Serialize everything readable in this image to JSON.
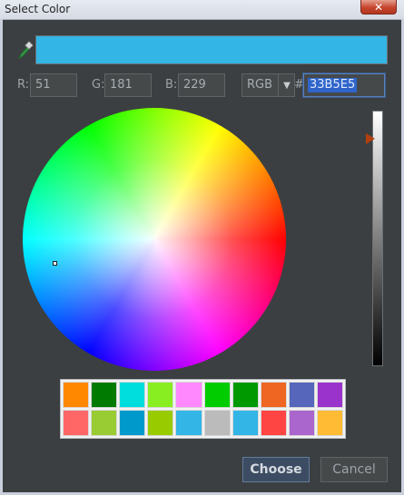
{
  "window": {
    "title": "Select Color",
    "close_glyph": "✕"
  },
  "selected_color": "#33B5E5",
  "rgb": {
    "r_label": "R:",
    "r_value": "51",
    "g_label": "G:",
    "g_value": "181",
    "b_label": "B:",
    "b_value": "229"
  },
  "mode": {
    "selected": "RGB",
    "arrow": "▼"
  },
  "hex": {
    "prefix": "#",
    "value": "33B5E5"
  },
  "icons": {
    "picker": "eyedropper-icon",
    "dropdown": "chevron-down-icon",
    "close": "close-icon"
  },
  "swatches": [
    "#FF8800",
    "#007A00",
    "#00DDDD",
    "#88EE22",
    "#FF88FF",
    "#00CC00",
    "#009900",
    "#EE6622",
    "#5566BB",
    "#9933CC",
    "#FF6666",
    "#99CC33",
    "#0099CC",
    "#99CC00",
    "#33B5E5",
    "#BBBBBB",
    "#33B5E5",
    "#FF4444",
    "#AA66CC",
    "#FFBB33"
  ],
  "buttons": {
    "choose": "Choose",
    "cancel": "Cancel"
  }
}
